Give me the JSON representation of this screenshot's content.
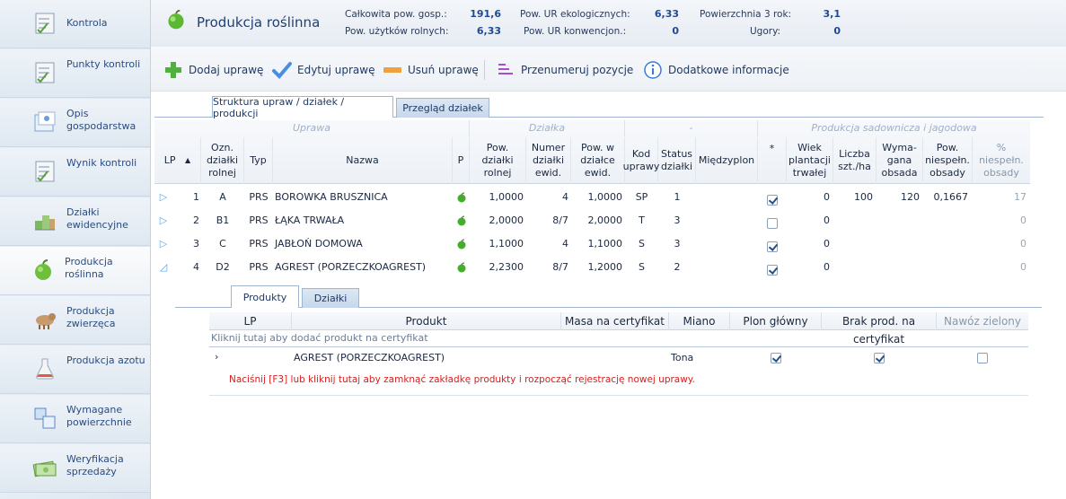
{
  "sidebar": {
    "items": [
      {
        "label": "Kontrola",
        "icon": "checklist-icon",
        "active": false
      },
      {
        "label": "Punkty kontroli",
        "icon": "checklist-icon",
        "active": false
      },
      {
        "label": "Opis gospodarstwa",
        "icon": "farm-description-icon",
        "active": false
      },
      {
        "label": "Wynik kontroli",
        "icon": "checklist-icon",
        "active": false
      },
      {
        "label": "Działki ewidencyjne",
        "icon": "parcel-icon",
        "active": false
      },
      {
        "label": "Produkcja roślinna",
        "icon": "apple-icon",
        "active": true
      },
      {
        "label": "Produkcja zwierzęca",
        "icon": "animal-icon",
        "active": false
      },
      {
        "label": "Produkcja azotu",
        "icon": "flask-icon",
        "active": false
      },
      {
        "label": "Wymagane powierzchnie",
        "icon": "areas-icon",
        "active": false
      },
      {
        "label": "Weryfikacja sprzedaży",
        "icon": "money-icon",
        "active": false
      }
    ]
  },
  "header": {
    "title": "Produkcja roślinna",
    "stats": [
      {
        "label": "Całkowita pow. gosp.:",
        "value": "191,6"
      },
      {
        "label": "Pow. użytków rolnych:",
        "value": "6,33"
      },
      {
        "label": "Pow. UR ekologicznych:",
        "value": "6,33"
      },
      {
        "label": "Pow. UR konwencjon.:",
        "value": "0"
      },
      {
        "label": "Powierzchnia 3 rok:",
        "value": "3,1"
      },
      {
        "label": "Ugory:",
        "value": "0"
      }
    ]
  },
  "toolbar": {
    "add": "Dodaj uprawę",
    "edit": "Edytuj uprawę",
    "delete": "Usuń uprawę",
    "renumber": "Przenumeruj pozycje",
    "info": "Dodatkowe informacje"
  },
  "tabs": {
    "structure": "Struktura upraw / działek / produkcji",
    "overview": "Przegląd działek"
  },
  "grid": {
    "bands": {
      "uprawa": "Uprawa",
      "dzialka": "Działka",
      "dash": "-",
      "sad": "Produkcja sadownicza i jagodowa"
    },
    "headers": {
      "lp": "LP",
      "ozn": "Ozn. działki rolnej",
      "typ": "Typ",
      "nazwa": "Nazwa",
      "p": "P",
      "pow": "Pow. działki rolnej",
      "numer": "Numer działki ewid.",
      "poww": "Pow. w działce ewid.",
      "kod": "Kod uprawy",
      "status": "Status działki",
      "miedzy": "Międzyplon",
      "star": "*",
      "wiek": "Wiek plantacji trwałej",
      "liczba": "Liczba szt./ha",
      "wymagana": "Wyma- gana obsada",
      "niespel": "Pow. niespełn. obsady",
      "pct": "% niespełn. obsady"
    },
    "rows": [
      {
        "lp": "1",
        "ozn": "A",
        "typ": "PRS",
        "nazwa": "BOROWKA BRUSZNICA",
        "pow": "1,0000",
        "numer": "4",
        "poww": "1,0000",
        "kod": "SP",
        "status": "1",
        "checked": true,
        "wiek": "0",
        "liczba": "100",
        "wymagana": "120",
        "niespel": "0,1667",
        "pct": "17"
      },
      {
        "lp": "2",
        "ozn": "B1",
        "typ": "PRS",
        "nazwa": "ŁĄKA TRWAŁA",
        "pow": "2,0000",
        "numer": "8/7",
        "poww": "2,0000",
        "kod": "T",
        "status": "3",
        "checked": false,
        "wiek": "0",
        "liczba": "",
        "wymagana": "",
        "niespel": "",
        "pct": "0"
      },
      {
        "lp": "3",
        "ozn": "C",
        "typ": "PRS",
        "nazwa": "JABŁOŃ DOMOWA",
        "pow": "1,1000",
        "numer": "4",
        "poww": "1,1000",
        "kod": "S",
        "status": "3",
        "checked": true,
        "wiek": "0",
        "liczba": "",
        "wymagana": "",
        "niespel": "",
        "pct": "0"
      },
      {
        "lp": "4",
        "ozn": "D2",
        "typ": "PRS",
        "nazwa": "AGREST (PORZECZKOAGREST)",
        "pow": "2,2300",
        "numer": "8/7",
        "poww": "1,2000",
        "kod": "S",
        "status": "2",
        "checked": true,
        "wiek": "0",
        "liczba": "",
        "wymagana": "",
        "niespel": "",
        "pct": "0"
      }
    ]
  },
  "subtabs": {
    "produkty": "Produkty",
    "dzialki": "Działki"
  },
  "subgrid": {
    "headers": {
      "lp": "LP",
      "produkt": "Produkt",
      "masa": "Masa na certyfikat",
      "miano": "Miano",
      "plon": "Plon główny",
      "brak": "Brak prod. na certyfikat",
      "nawoz": "Nawóz zielony"
    },
    "add_hint": "Kliknij tutaj aby dodać produkt na certyfikat",
    "row": {
      "produkt": "AGREST (PORZECZKOAGREST)",
      "miano": "Tona",
      "plon": true,
      "brak": true,
      "nawoz": false
    },
    "f3_hint": "Naciśnij  [F3]  lub kliknij tutaj aby zamknąć zakładkę produkty i rozpocząć rejestrację nowej uprawy."
  },
  "colors": {
    "accent": "#1f4a8f",
    "warning": "#d42020"
  }
}
